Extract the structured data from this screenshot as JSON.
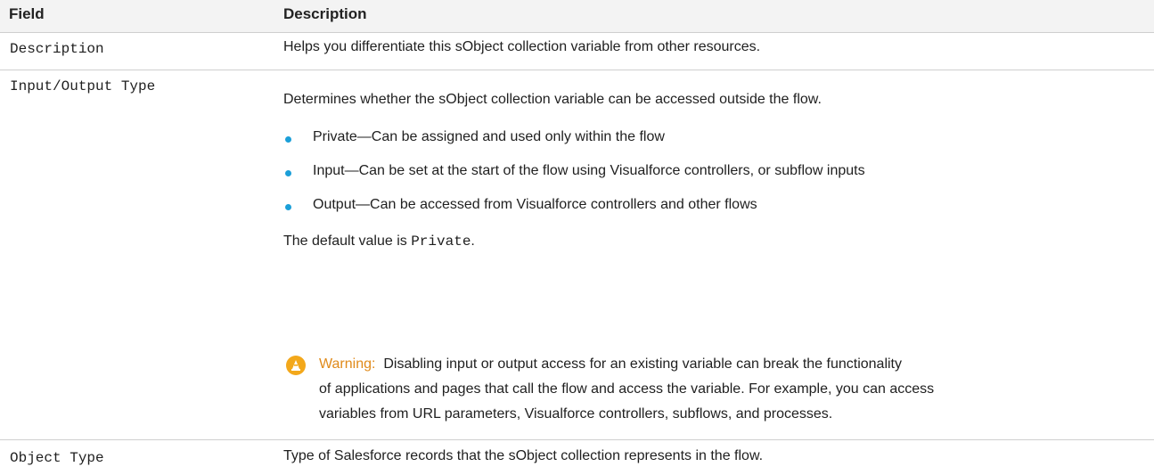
{
  "header": {
    "field": "Field",
    "description": "Description"
  },
  "rows": [
    {
      "field": "Description",
      "description": "Helps you differentiate this sObject collection variable from other resources."
    },
    {
      "field": "Input/Output Type",
      "intro": "Determines whether the sObject collection variable can be accessed outside the flow.",
      "bullets": [
        "Private—Can be assigned and used only within the flow",
        "Input—Can be set at the start of the flow using Visualforce controllers, or subflow inputs",
        "Output—Can be accessed from Visualforce controllers and other flows"
      ],
      "default_prefix": "The default value is ",
      "default_value": "Private",
      "default_suffix": ".",
      "warning": {
        "label": "Warning:",
        "lines": [
          "Disabling input or output access for an existing variable can break the functionality",
          "of applications and pages that call the flow and access the variable. For example, you can access",
          "variables from URL parameters, Visualforce controllers, subflows, and processes."
        ]
      }
    },
    {
      "field": "Object Type",
      "description": "Type of Salesforce records that the sObject collection represents in the flow."
    }
  ],
  "colors": {
    "bullet": "#1b9fd8",
    "warning_icon": "#f3a81b",
    "warning_label": "#e08a1a",
    "header_bg": "#f3f3f3"
  },
  "icons": {
    "warning": "warning-cone-icon",
    "bullet": "bullet-dot-icon"
  }
}
